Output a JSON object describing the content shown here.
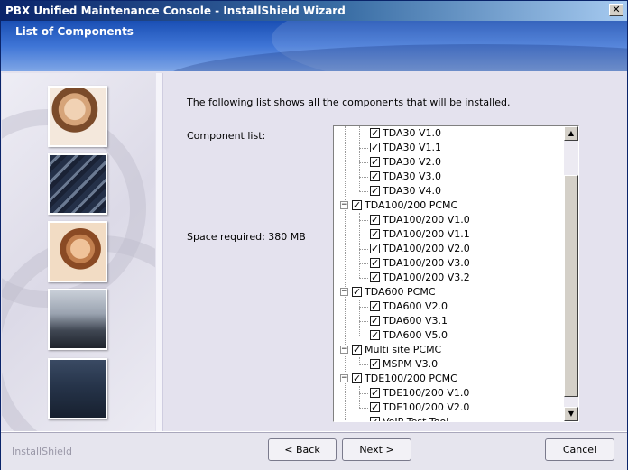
{
  "window": {
    "title": "PBX Unified Maintenance Console - InstallShield Wizard",
    "close_glyph": "✕"
  },
  "header": {
    "title": "List of Components"
  },
  "main": {
    "intro": "The following list shows all the components that will be installed.",
    "component_list_label": "Component list:",
    "space_required": "Space required: 380 MB"
  },
  "tree": {
    "items": [
      {
        "label": "TDA30 V1.0",
        "checked": true
      },
      {
        "label": "TDA30 V1.1",
        "checked": true
      },
      {
        "label": "TDA30 V2.0",
        "checked": true
      },
      {
        "label": "TDA30 V3.0",
        "checked": true
      },
      {
        "label": "TDA30 V4.0",
        "checked": true
      },
      {
        "label": "TDA100/200 PCMC",
        "checked": true,
        "expander": "−"
      },
      {
        "label": "TDA100/200 V1.0",
        "checked": true
      },
      {
        "label": "TDA100/200 V1.1",
        "checked": true
      },
      {
        "label": "TDA100/200 V2.0",
        "checked": true
      },
      {
        "label": "TDA100/200 V3.0",
        "checked": true
      },
      {
        "label": "TDA100/200 V3.2",
        "checked": true
      },
      {
        "label": "TDA600 PCMC",
        "checked": true,
        "expander": "−"
      },
      {
        "label": "TDA600 V2.0",
        "checked": true
      },
      {
        "label": "TDA600 V3.1",
        "checked": true
      },
      {
        "label": "TDA600 V5.0",
        "checked": true
      },
      {
        "label": "Multi site PCMC",
        "checked": true,
        "expander": "−"
      },
      {
        "label": "MSPM V3.0",
        "checked": true
      },
      {
        "label": "TDE100/200 PCMC",
        "checked": true,
        "expander": "−"
      },
      {
        "label": "TDE100/200 V1.0",
        "checked": true
      },
      {
        "label": "TDE100/200 V2.0",
        "checked": true
      },
      {
        "label": "VoIP Test Tool",
        "checked": true
      }
    ],
    "scroll_up_glyph": "▲",
    "scroll_down_glyph": "▼"
  },
  "footer": {
    "brand": "InstallShield",
    "back_label": "< Back",
    "next_label": "Next >",
    "cancel_label": "Cancel"
  },
  "icons": {
    "close": "close-icon",
    "scroll_up": "arrow-up-icon",
    "scroll_down": "arrow-down-icon",
    "checkbox": "checkbox-checked-icon",
    "collapse": "collapse-icon"
  },
  "colors": {
    "titlebar": "#0a246a",
    "header": "#3f75d6",
    "panel": "#e4e2ee"
  }
}
